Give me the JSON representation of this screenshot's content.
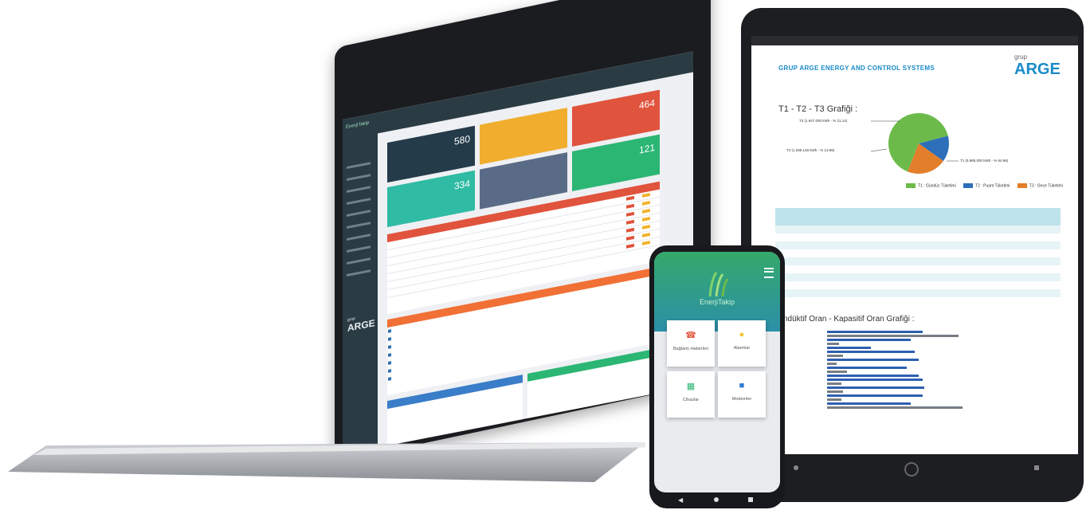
{
  "laptop": {
    "app_logo": "EnerjiTakip",
    "brand_small": "grup",
    "brand": "ARGE",
    "tiles": [
      {
        "num": "580",
        "color": "#243b4a"
      },
      {
        "num": "",
        "color": "#f0ad2e"
      },
      {
        "num": "464",
        "color": "#e0533d"
      },
      {
        "num": "334",
        "color": "#2fbba4"
      },
      {
        "num": "",
        "color": "#5a6b87"
      },
      {
        "num": "121",
        "color": "#2bb673"
      }
    ],
    "panels": {
      "alarms_color": "#e0533d",
      "list_color": "#f17035",
      "blue_color": "#3a7dc9",
      "green_color": "#2bb673"
    }
  },
  "tablet": {
    "title": "GRUP ARGE ENERGY AND CONTROL SYSTEMS",
    "logo_small": "grup",
    "logo": "ARGE",
    "chart1_title": "T1 - T2 - T3 Grafiği :",
    "chart2_title": "ndüktif Oran - Kapasitif Oran Grafiği :",
    "pie_labels": [
      "T3 (1.947.000 kWh - % 21.14)",
      "T2 (1.286.148 kWh - % 13.89)",
      "T1 (5.985.000 kWh - % 64.96)"
    ],
    "legend": [
      "T1 : Gündüz Tüketimi",
      "T2 : Puant Tüketimi",
      "T3 : Gece Tüketimi"
    ],
    "colors": {
      "t1": "#6cbb4a",
      "t2": "#2d6fb9",
      "t3": "#e37e2a",
      "bar_blue": "#2d5fb0",
      "bar_gray": "#777d85"
    }
  },
  "chart_data": {
    "type": "pie",
    "title": "T1 - T2 - T3 Grafiği :",
    "categories": [
      "T1 : Gündüz Tüketimi",
      "T2 : Puant Tüketimi",
      "T3 : Gece Tüketimi"
    ],
    "values": [
      64.96,
      13.89,
      21.14
    ],
    "legend": "bottom"
  },
  "phone": {
    "brand": "EnerjiTakip",
    "cards": [
      {
        "label": "Bağlantı Haberleri",
        "icon": "phone-icon",
        "color": "#e0533d"
      },
      {
        "label": "Alarmlar",
        "icon": "bell-icon",
        "color": "#f1c232"
      },
      {
        "label": "Cihazlar",
        "icon": "grid-icon",
        "color": "#2bb673"
      },
      {
        "label": "Modemler",
        "icon": "square-icon",
        "color": "#2d78d6"
      }
    ]
  }
}
